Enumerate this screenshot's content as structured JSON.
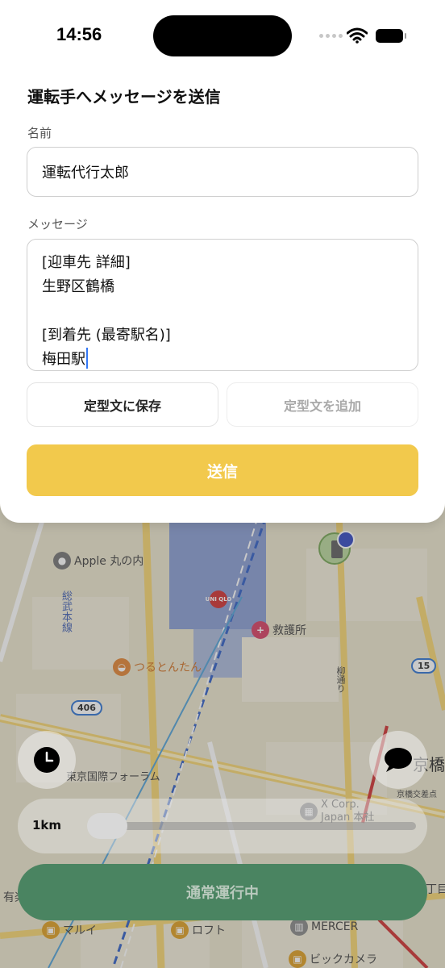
{
  "status_bar": {
    "time": "14:56"
  },
  "sheet": {
    "title": "運転手へメッセージを送信",
    "name_label": "名前",
    "name_value": "運転代行太郎",
    "message_label": "メッセージ",
    "message_lines": [
      "[迎車先 詳細]",
      "生野区鶴橋",
      "",
      "[到着先 (最寄駅名)]",
      "梅田駅"
    ],
    "save_template_label": "定型文に保存",
    "add_template_label": "定型文を追加",
    "send_label": "送信",
    "send_color": "#f2c94c"
  },
  "map": {
    "pois": {
      "apple": "Apple 丸の内",
      "uniqlo": "UNI QLO",
      "aid": "救護所",
      "tsurutontan": "つるとんたん",
      "forum": "東京国際フォーラム",
      "xcorp": "X Corp. Japan 本社",
      "loft": "ロフト",
      "marui": "マルイ",
      "mercer": "MERCER",
      "bic": "ビックカメラ",
      "kyobashi": "京橋",
      "yurakucho": "有楽",
      "sobu_line": "総武本線",
      "yanagi": "柳通り",
      "nichome": "丁目",
      "kyobashi_sub": "京橋交差点"
    },
    "route_badges": [
      "406",
      "15"
    ]
  },
  "controls": {
    "radius_label": "1km",
    "radius_value_fraction": 0.0,
    "status_label": "通常運行中",
    "status_color": "#4a8461"
  }
}
